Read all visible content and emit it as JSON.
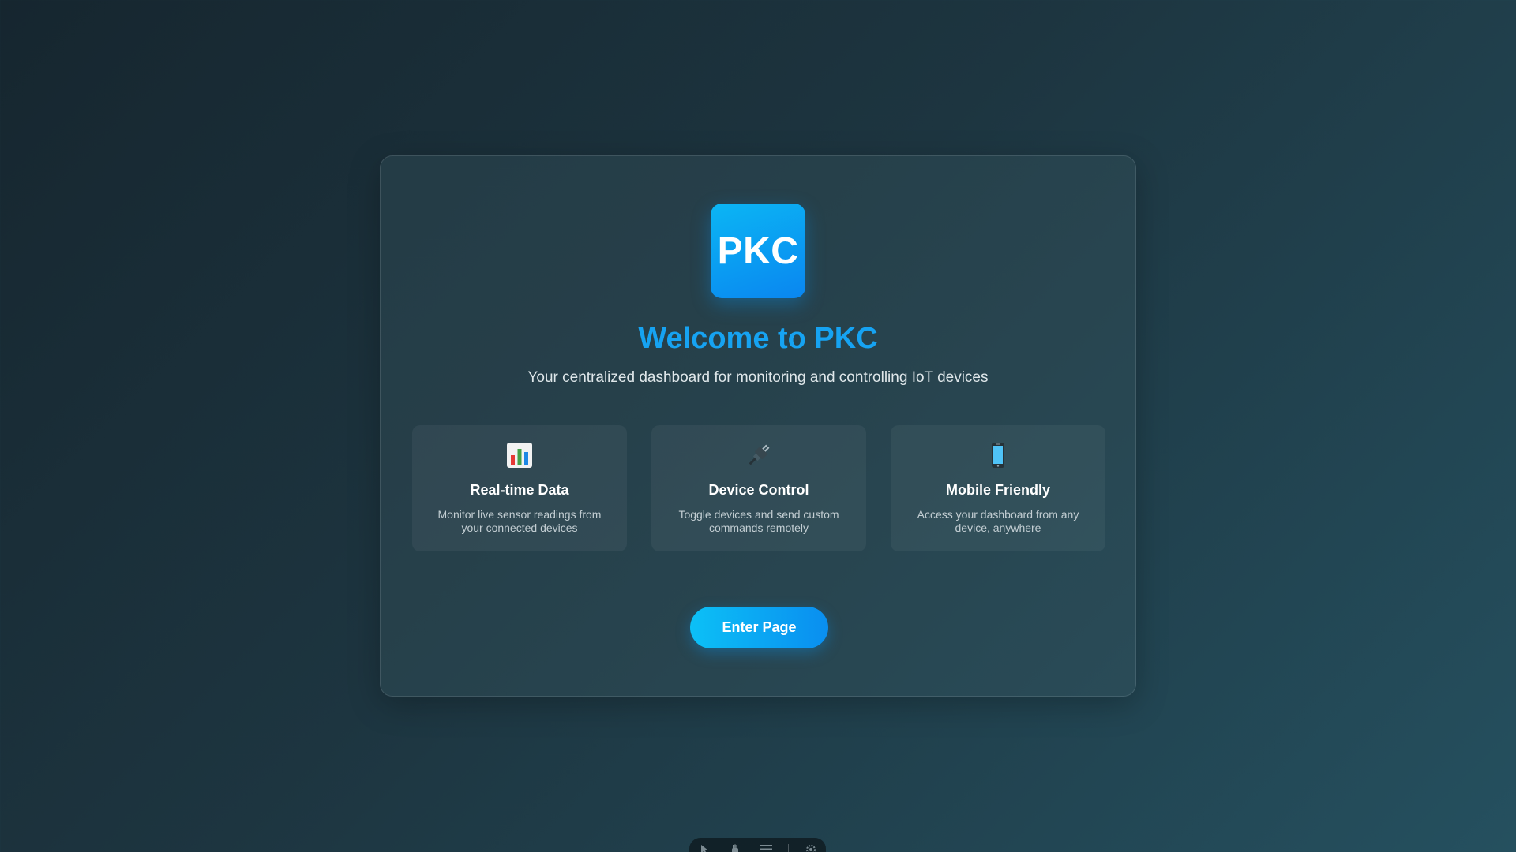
{
  "logo": {
    "text": "PKC"
  },
  "title": "Welcome to PKC",
  "subtitle": "Your centralized dashboard for monitoring and controlling IoT devices",
  "features": [
    {
      "icon": "bar-chart-icon",
      "title": "Real-time Data",
      "description": "Monitor live sensor readings from your connected devices"
    },
    {
      "icon": "plug-icon",
      "title": "Device Control",
      "description": "Toggle devices and send custom commands remotely"
    },
    {
      "icon": "mobile-phone-icon",
      "title": "Mobile Friendly",
      "description": "Access your dashboard from any device, anywhere"
    }
  ],
  "enter_button": {
    "label": "Enter Page"
  },
  "dock": {
    "items": [
      "pointer-icon",
      "hand-icon",
      "menu-icon",
      "settings-icon"
    ]
  },
  "colors": {
    "accent": "#16a3f2",
    "button_start": "#0cc0f6",
    "button_end": "#0a8ef0",
    "background_dark": "#16262f",
    "background_light": "#25505f"
  }
}
